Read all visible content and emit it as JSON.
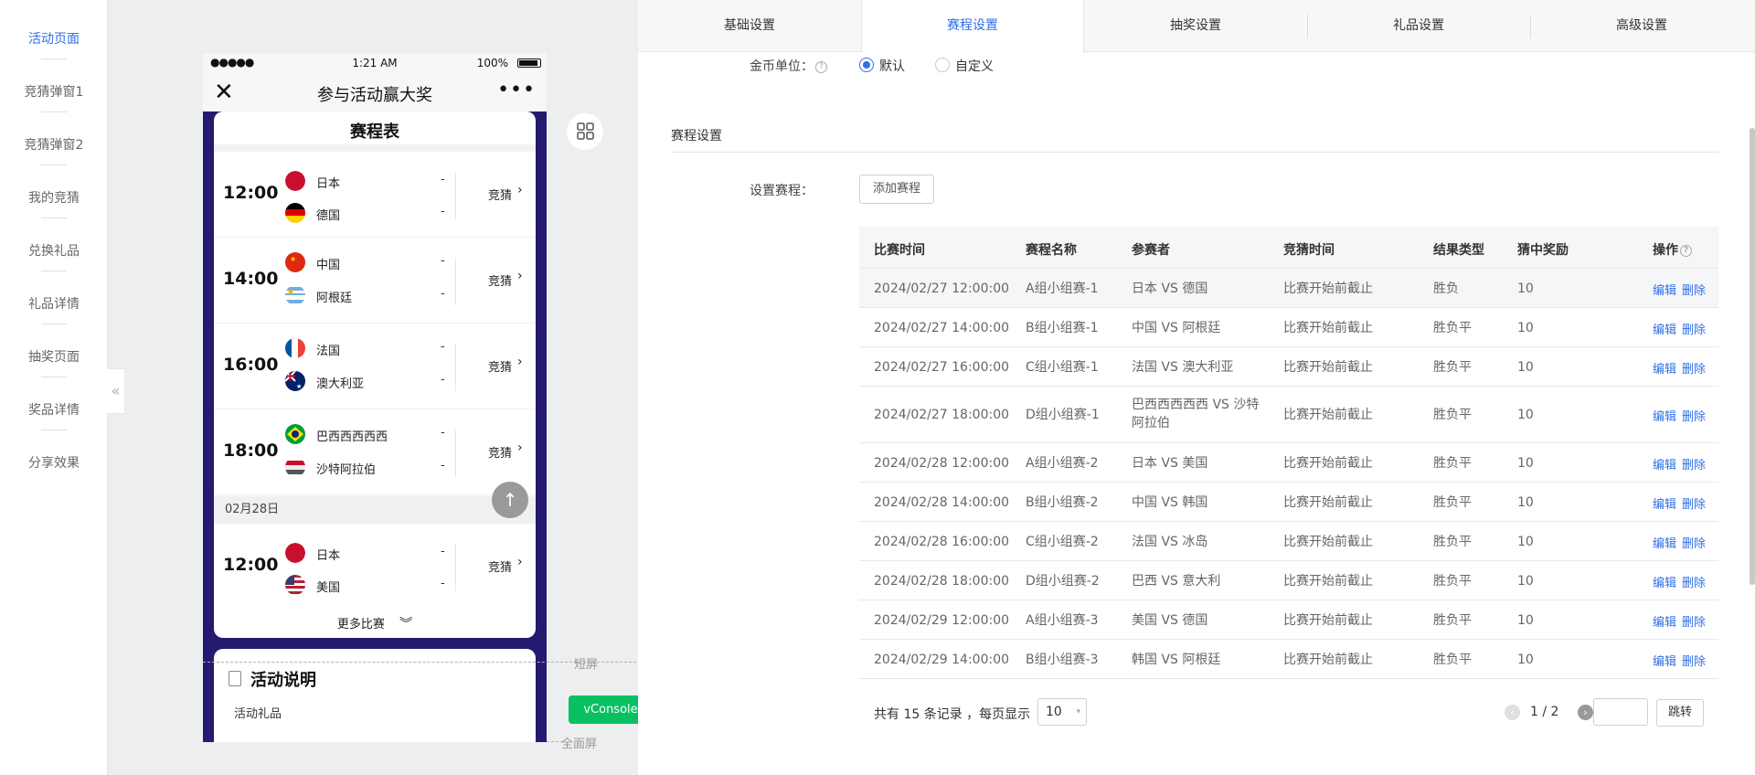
{
  "leftnav": {
    "items": [
      {
        "label": "活动页面",
        "active": true
      },
      {
        "label": "竞猜弹窗1"
      },
      {
        "label": "竞猜弹窗2"
      },
      {
        "label": "我的竞猜"
      },
      {
        "label": "兑换礼品"
      },
      {
        "label": "礼品详情"
      },
      {
        "label": "抽奖页面"
      },
      {
        "label": "奖品详情"
      },
      {
        "label": "分享效果"
      }
    ],
    "collapse_glyph": "«"
  },
  "phone": {
    "status": {
      "signal": "●●●●●",
      "time": "1:21 AM",
      "battery": "100%"
    },
    "navbar": {
      "close": "✕",
      "title": "参与活动赢大奖",
      "more": "•••"
    },
    "schedule_title": "赛程表",
    "guess_label": "竞猜",
    "guess_arrow": "›",
    "matches": [
      {
        "time": "12:00",
        "team1": "日本",
        "team2": "德国",
        "score1": "-",
        "score2": "-"
      },
      {
        "time": "14:00",
        "team1": "中国",
        "team2": "阿根廷",
        "score1": "-",
        "score2": "-"
      },
      {
        "time": "16:00",
        "team1": "法国",
        "team2": "澳大利亚",
        "score1": "-",
        "score2": "-"
      },
      {
        "time": "18:00",
        "team1": "巴西西西西西",
        "team2": "沙特阿拉伯",
        "score1": "-",
        "score2": "-"
      },
      {
        "time": "12:00",
        "team1": "日本",
        "team2": "美国",
        "score1": "-",
        "score2": "-"
      }
    ],
    "date_divider": "02月28日",
    "more_matches": "更多比赛",
    "more_arrow": "︾",
    "back_top": "↑",
    "desc_title": "活动说明",
    "desc_sub": "活动礼品",
    "vconsole": "vConsole"
  },
  "markers": {
    "short": "短屏",
    "full": "全面屏"
  },
  "tabs": [
    "基础设置",
    "赛程设置",
    "抽奖设置",
    "礼品设置",
    "高级设置"
  ],
  "active_tab": 1,
  "coin": {
    "label": "金币单位：",
    "help": "?",
    "options": [
      "默认",
      "自定义"
    ],
    "selected": 0
  },
  "section": {
    "title": "赛程设置",
    "set_label": "设置赛程：",
    "add_button": "添加赛程"
  },
  "table": {
    "headers": [
      "比赛时间",
      "赛程名称",
      "参赛者",
      "竞猜时间",
      "结果类型",
      "猜中奖励",
      "操作"
    ],
    "op_help": "?",
    "edit_label": "编辑",
    "delete_label": "删除",
    "rows": [
      {
        "time": "2024/02/27 12:00:00",
        "name": "A组小组赛-1",
        "players": "日本 VS 德国",
        "guess_time": "比赛开始前截止",
        "result": "胜负",
        "reward": "10"
      },
      {
        "time": "2024/02/27 14:00:00",
        "name": "B组小组赛-1",
        "players": "中国 VS 阿根廷",
        "guess_time": "比赛开始前截止",
        "result": "胜负平",
        "reward": "10"
      },
      {
        "time": "2024/02/27 16:00:00",
        "name": "C组小组赛-1",
        "players": "法国 VS 澳大利亚",
        "guess_time": "比赛开始前截止",
        "result": "胜负平",
        "reward": "10"
      },
      {
        "time": "2024/02/27 18:00:00",
        "name": "D组小组赛-1",
        "players": "巴西西西西西 VS 沙特",
        "players2": "阿拉伯",
        "guess_time": "比赛开始前截止",
        "result": "胜负平",
        "reward": "10"
      },
      {
        "time": "2024/02/28 12:00:00",
        "name": "A组小组赛-2",
        "players": "日本 VS 美国",
        "guess_time": "比赛开始前截止",
        "result": "胜负平",
        "reward": "10"
      },
      {
        "time": "2024/02/28 14:00:00",
        "name": "B组小组赛-2",
        "players": "中国 VS 韩国",
        "guess_time": "比赛开始前截止",
        "result": "胜负平",
        "reward": "10"
      },
      {
        "time": "2024/02/28 16:00:00",
        "name": "C组小组赛-2",
        "players": "法国 VS 冰岛",
        "guess_time": "比赛开始前截止",
        "result": "胜负平",
        "reward": "10"
      },
      {
        "time": "2024/02/28 18:00:00",
        "name": "D组小组赛-2",
        "players": "巴西 VS 意大利",
        "guess_time": "比赛开始前截止",
        "result": "胜负平",
        "reward": "10"
      },
      {
        "time": "2024/02/29 12:00:00",
        "name": "A组小组赛-3",
        "players": "美国 VS 德国",
        "guess_time": "比赛开始前截止",
        "result": "胜负平",
        "reward": "10"
      },
      {
        "time": "2024/02/29 14:00:00",
        "name": "B组小组赛-3",
        "players": "韩国 VS 阿根廷",
        "guess_time": "比赛开始前截止",
        "result": "胜负平",
        "reward": "10"
      }
    ]
  },
  "pager": {
    "total": "共有 15 条记录 ，每页显示",
    "page_size": "10",
    "page_info": "1 / 2",
    "prev": "‹",
    "next": "›",
    "jump": "跳转",
    "size_arrow": "▾"
  },
  "colors": {
    "accent": "#2f6fe6",
    "phone_bg": "#241b70",
    "vconsole": "#07c160"
  }
}
